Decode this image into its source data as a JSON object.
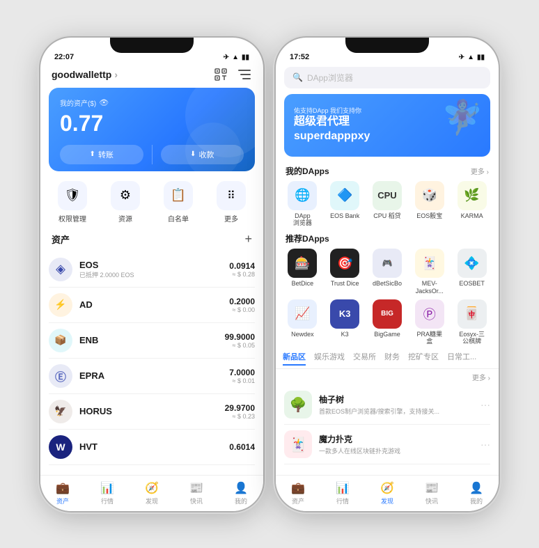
{
  "left_phone": {
    "status_bar": {
      "time": "22:07",
      "icons": [
        "✈",
        "WiFi",
        "🔋"
      ]
    },
    "header": {
      "wallet_name": "goodwallettp",
      "arrow": "›"
    },
    "balance_card": {
      "label": "我的资产($)",
      "amount": "0.77",
      "btn_transfer": "转账",
      "btn_receive": "收款"
    },
    "quick_actions": [
      {
        "id": "permissions",
        "label": "权限管理",
        "icon": "🛡"
      },
      {
        "id": "resources",
        "label": "资源",
        "icon": "⚙"
      },
      {
        "id": "whitelist",
        "label": "白名单",
        "icon": "📋"
      },
      {
        "id": "more",
        "label": "更多",
        "icon": "⚏"
      }
    ],
    "assets_section": {
      "title": "资产",
      "add_icon": "+"
    },
    "assets": [
      {
        "name": "EOS",
        "sub": "已抵押 2.0000 EOS",
        "amount": "0.0914",
        "usd": "≈ $ 0.28",
        "icon": "◈",
        "color": "#3949ab"
      },
      {
        "name": "AD",
        "sub": "",
        "amount": "0.2000",
        "usd": "≈ $ 0.00",
        "icon": "⚡",
        "color": "#f57c00"
      },
      {
        "name": "ENB",
        "sub": "",
        "amount": "99.9000",
        "usd": "≈ $ 0.05",
        "icon": "📦",
        "color": "#00897b"
      },
      {
        "name": "EPRA",
        "sub": "",
        "amount": "7.0000",
        "usd": "≈ $ 0.01",
        "icon": "Ⓔ",
        "color": "#5c6bc0"
      },
      {
        "name": "HORUS",
        "sub": "",
        "amount": "29.9700",
        "usd": "≈ $ 0.23",
        "icon": "🦅",
        "color": "#6d4c41"
      },
      {
        "name": "HVT",
        "sub": "",
        "amount": "0.6014",
        "usd": "",
        "icon": "W",
        "color": "#1a237e"
      }
    ],
    "bottom_nav": [
      {
        "id": "assets",
        "label": "资产",
        "icon": "💼",
        "active": true
      },
      {
        "id": "market",
        "label": "行情",
        "icon": "📊",
        "active": false
      },
      {
        "id": "discover",
        "label": "发现",
        "icon": "🧭",
        "active": false
      },
      {
        "id": "news",
        "label": "快讯",
        "icon": "📰",
        "active": false
      },
      {
        "id": "me",
        "label": "我的",
        "icon": "👤",
        "active": false
      }
    ]
  },
  "right_phone": {
    "status_bar": {
      "time": "17:52",
      "icons": [
        "✈",
        "WiFi",
        "🔋"
      ]
    },
    "search": {
      "placeholder": "DApp浏览器"
    },
    "banner": {
      "sub": "佑支持DApp 我们支持你",
      "main": "超级君代理\nsuperdapppxy"
    },
    "my_dapps": {
      "title": "我的DApps",
      "more": "更多 ›",
      "items": [
        {
          "id": "dapp-browser",
          "label": "DApp\n浏览器",
          "icon": "🌐",
          "color_class": "ic-blue"
        },
        {
          "id": "eos-bank",
          "label": "EOS Bank",
          "icon": "🔷",
          "color_class": "ic-teal"
        },
        {
          "id": "cpu-rental",
          "label": "CPU 稻贷",
          "icon": "💻",
          "color_class": "ic-green"
        },
        {
          "id": "eos-dice",
          "label": "EOS骰宝",
          "icon": "🎲",
          "color_class": "ic-orange"
        },
        {
          "id": "karma",
          "label": "KARMA",
          "icon": "🌿",
          "color_class": "ic-lime"
        }
      ]
    },
    "recommended_dapps": {
      "title": "推荐DApps",
      "rows": [
        [
          {
            "id": "betdice",
            "label": "BetDice",
            "icon": "🎰",
            "color_class": "ic-dark"
          },
          {
            "id": "trust-dice",
            "label": "Trust Dice",
            "icon": "🎯",
            "color_class": "ic-dark"
          },
          {
            "id": "dbetsicbo",
            "label": "dBetSicBo",
            "icon": "🎮",
            "color_class": "ic-indigo"
          },
          {
            "id": "mev-jacks",
            "label": "MEV-\nJacksOr...",
            "icon": "🃏",
            "color_class": "ic-amber"
          },
          {
            "id": "eosbet",
            "label": "EOSBET",
            "icon": "💠",
            "color_class": "ic-silver"
          }
        ],
        [
          {
            "id": "newdex",
            "label": "Newdex",
            "icon": "📈",
            "color_class": "ic-blue"
          },
          {
            "id": "k3",
            "label": "K3",
            "icon": "K3",
            "color_class": "ic-indigo"
          },
          {
            "id": "biggame",
            "label": "BigGame",
            "icon": "BIG",
            "color_class": "ic-red"
          },
          {
            "id": "pra",
            "label": "PRA糖果\n盒",
            "icon": "Ⓟ",
            "color_class": "ic-purple"
          },
          {
            "id": "eosyx",
            "label": "Eosyx-三\n公棋牌",
            "icon": "🀄",
            "color_class": "ic-silver"
          }
        ]
      ]
    },
    "tabs": [
      {
        "id": "new",
        "label": "新品区",
        "active": true
      },
      {
        "id": "entertainment",
        "label": "娱乐游戏",
        "active": false
      },
      {
        "id": "exchange",
        "label": "交易所",
        "active": false
      },
      {
        "id": "finance",
        "label": "财务",
        "active": false
      },
      {
        "id": "mining",
        "label": "挖矿专区",
        "active": false
      },
      {
        "id": "daily",
        "label": "日常工...",
        "active": false
      }
    ],
    "app_list": {
      "more": "更多 ›",
      "items": [
        {
          "id": "yuzishu",
          "name": "柚子树",
          "desc": "首款EOS制户浏览器/搜索引擎，支持接关...",
          "icon": "🌳",
          "color_class": "ic-green"
        },
        {
          "id": "magic-poker",
          "name": "魔力扑克",
          "desc": "一款多人在线区块链扑克游戏",
          "icon": "🃏",
          "color_class": "ic-red"
        }
      ]
    },
    "bottom_nav": [
      {
        "id": "assets",
        "label": "资产",
        "icon": "💼",
        "active": false
      },
      {
        "id": "market",
        "label": "行情",
        "icon": "📊",
        "active": false
      },
      {
        "id": "discover",
        "label": "发现",
        "icon": "🧭",
        "active": true
      },
      {
        "id": "news",
        "label": "快讯",
        "icon": "📰",
        "active": false
      },
      {
        "id": "me",
        "label": "我的",
        "icon": "👤",
        "active": false
      }
    ]
  }
}
